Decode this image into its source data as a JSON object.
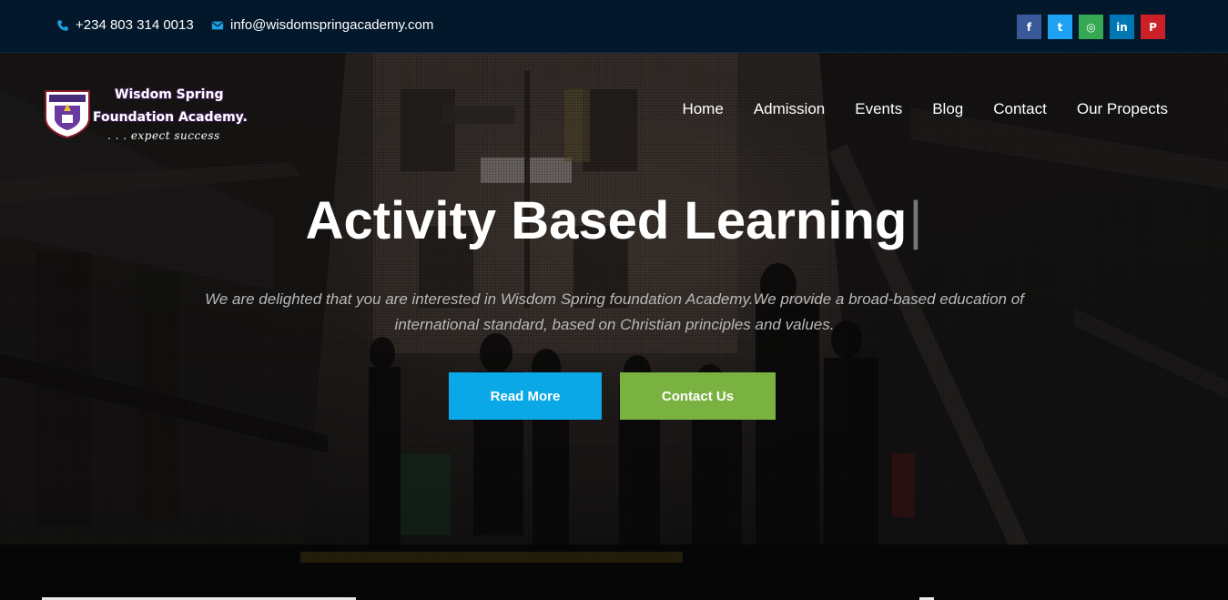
{
  "topbar": {
    "phone": "+234 803 314 0013",
    "email": "info@wisdomspringacademy.com",
    "socials": [
      {
        "icon": "facebook-icon",
        "glyph": "f",
        "color": "#3b5998"
      },
      {
        "icon": "twitter-icon",
        "glyph": "t",
        "color": "#1da1f2"
      },
      {
        "icon": "instagram-icon",
        "glyph": "◎",
        "color": "#34a853"
      },
      {
        "icon": "linkedin-icon",
        "glyph": "in",
        "color": "#0077b5"
      },
      {
        "icon": "pinterest-icon",
        "glyph": "P",
        "color": "#cb2027"
      }
    ]
  },
  "logo": {
    "name_line1": "Wisdom Spring",
    "name_line2": "Foundation Academy.",
    "tagline": ". . . expect success"
  },
  "nav": {
    "items": [
      "Home",
      "Admission",
      "Events",
      "Blog",
      "Contact",
      "Our Propects"
    ]
  },
  "hero": {
    "headline": "Activity Based Learning",
    "cursor": "|",
    "subtitle": "We are delighted that you are interested in Wisdom Spring foundation Academy.We provide a broad-based education of international standard, based on Christian principles and values.",
    "read_more": "Read More",
    "contact_us": "Contact Us"
  },
  "colors": {
    "topbar": "#03192b",
    "read_more": "#0aa8e6",
    "contact_us": "#7ab241"
  }
}
